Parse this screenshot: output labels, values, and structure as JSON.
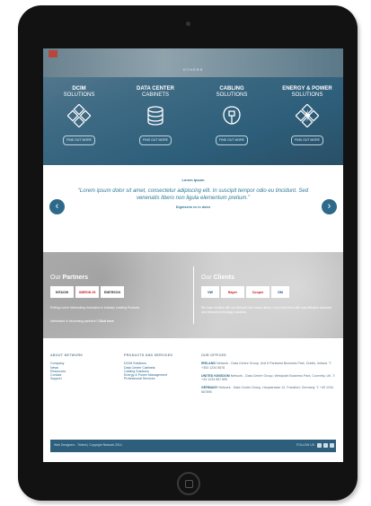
{
  "hero": {
    "brand": "OTHERS",
    "solutions": [
      {
        "line1": "DCIM",
        "line2": "SOLUTIONS",
        "button": "FIND OUT MORE",
        "icon": "dcim-icon"
      },
      {
        "line1": "DATA CENTER",
        "line2": "CABINETS",
        "button": "FIND OUT MORE",
        "icon": "database-icon"
      },
      {
        "line1": "CABLING",
        "line2": "SOLUTIONS",
        "button": "FIND OUT MORE",
        "icon": "cable-icon"
      },
      {
        "line1": "ENERGY & POWER",
        "line2": "SOLUTIONS",
        "button": "FIND OUT MORE",
        "icon": "energy-icon"
      }
    ]
  },
  "testimonial": {
    "kicker": "Lorem Ipsum",
    "quote": "“Lorem ipsum dolor sit amet, consectetur adipiscing elit. In suscipit tempor odio eu tincidunt. Sed venenatis libero non ligula elementum pretium.”",
    "author": "Dignissim ex in dolor",
    "prev": "‹",
    "next": "›"
  },
  "partners": {
    "title_light": "Our ",
    "title_bold": "Partners",
    "logos": [
      "HITACHI",
      "OMRON 29",
      "EMERSON"
    ],
    "description": "Putting Lorem Networking Innovation & Industry Leading Products",
    "cta_text": "Interested in becoming partners?",
    "cta_link": "Click here"
  },
  "clients": {
    "title_light": "Our ",
    "title_bold": "Clients",
    "logos": [
      "VW",
      "Bayer",
      "Cooper",
      "GM"
    ],
    "description": "We have worked with our Network and many clients, to provide them with cost-effective solutions and network technology solutions."
  },
  "footer": {
    "about": {
      "heading": "ABOUT NETWORK",
      "links": [
        "Company",
        "News",
        "Resources",
        "Contact",
        "Support"
      ]
    },
    "products": {
      "heading": "PRODUCTS AND SERVICES",
      "links": [
        "DCIM Solutions",
        "Data Center Cabinets",
        "Cabling Solutions",
        "Energy & Power Management",
        "Professional Services"
      ]
    },
    "offices": {
      "heading": "OUR OFFICES",
      "items": [
        {
          "name": "IRELAND",
          "text": "Network - Data Centre Group, Unit 6 Parkwest Business Park, Dublin, Ireland. T: +353 1234 5678"
        },
        {
          "name": "UNITED KINGDOM",
          "text": "Network - Data Centre Group, Westpoint Business Park, Coventry, UK. T: +44 1234 567 890"
        },
        {
          "name": "GERMANY",
          "text": "Network - Data Centre Group, Haupstrasse 12, Frankfurt, Germany. T: +49 1234 567890"
        }
      ]
    },
    "copyright": "Web Designers - Trident | Copyright Network 2014",
    "follow": "FOLLOW US"
  },
  "colors": {
    "accent": "#2d6a8a",
    "footer_bar": "#2d5f7d"
  }
}
